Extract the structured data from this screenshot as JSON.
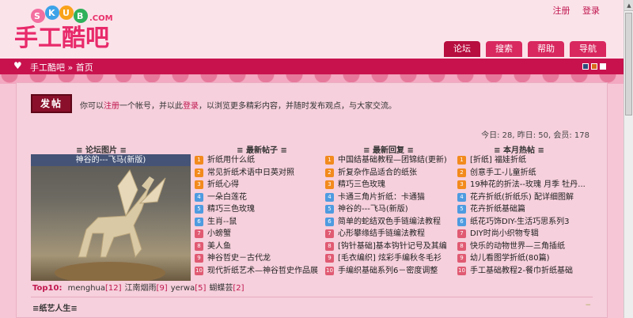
{
  "logo": {
    "top_text": "SKUB.COM",
    "main_text": "手工酷吧"
  },
  "top_links": [
    {
      "label": "注册"
    },
    {
      "label": "登录"
    }
  ],
  "nav_tabs": [
    {
      "label": "论坛"
    },
    {
      "label": "搜索"
    },
    {
      "label": "帮助"
    },
    {
      "label": "导航"
    }
  ],
  "crumbs": {
    "site": "手工酷吧",
    "sep": "»",
    "current": "首页"
  },
  "style_colors": [
    "#2e4a7a",
    "#d86a1a",
    "#ffffff"
  ],
  "post_button": {
    "label": "发帖"
  },
  "welcome": {
    "prefix": "你可以",
    "register": "注册",
    "middle": "一个帐号，并以此",
    "login": "登录",
    "suffix": "，以浏览更多精彩内容，并随时发布观点，与大家交流。"
  },
  "stats": {
    "text": "今日: 28, 昨日: 50, 会员: 178"
  },
  "columns": {
    "pics": "论坛图片",
    "new": "最新帖子",
    "reply": "最新回复",
    "hot": "本月热帖"
  },
  "photo": {
    "caption": "神谷的---飞马(新版)"
  },
  "new_posts": [
    "折纸用什么纸",
    "常见折纸术语中日英对照",
    "折纸心得",
    "一朵白莲花",
    "精巧三色玫瑰",
    "生肖--鼠",
    "小螃蟹",
    "美人鱼",
    "神谷哲史－古代龙",
    "现代折纸艺术—神谷哲史作品展"
  ],
  "new_replies": [
    "中国结基础教程—团锦结(更新)",
    "折复杂作品适合的纸张",
    "精巧三色玫瑰",
    "卡通三角片折纸：卡通猫",
    "神谷的---飞马(新版)",
    "简单的蛇结双色手链编法教程",
    "心形攀缘结手链编法教程",
    "[钩针基础]基本钩针记号及其编",
    "[毛衣编织] 炫彩手编秋冬毛衫",
    "手编织基础系列6－密度调整"
  ],
  "hot_posts": [
    "[折纸] 福娃折纸",
    "创意手工-儿童折纸",
    "19种花的折法--玫瑰 月季 牡丹...",
    "花卉折纸(折纸乐) 配详细图解",
    "花卉折纸基础篇",
    "纸花巧饰DIY-生活巧思系列3",
    "DIY时尚小织物专辑",
    "快乐的动物世界—三角插纸",
    "幼儿看图学折纸(80篇)",
    "手工基础教程2-餐巾折纸基础"
  ],
  "number_labels": [
    "1",
    "2",
    "3",
    "4",
    "5",
    "6",
    "7",
    "8",
    "9",
    "10"
  ],
  "top10": {
    "label": "Top10:",
    "users": [
      {
        "name": "menghua",
        "count": "[12]"
      },
      {
        "name": "江南烟雨",
        "count": "[9]"
      },
      {
        "name": "yerwa",
        "count": "[5]"
      },
      {
        "name": "蝴蝶芸",
        "count": "[2]"
      }
    ]
  },
  "section": {
    "title": "纸艺人生",
    "toggle": "−"
  }
}
